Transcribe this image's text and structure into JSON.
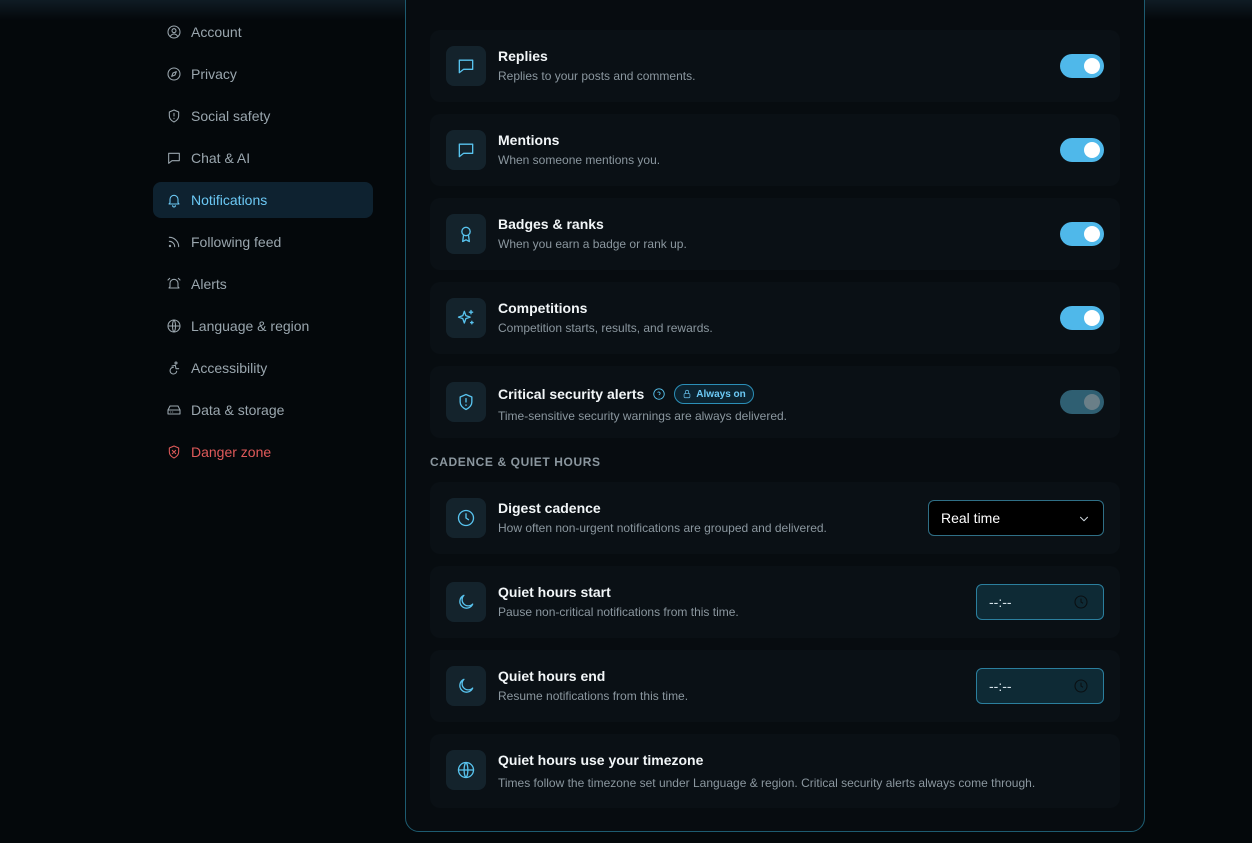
{
  "sidebar": {
    "items": [
      {
        "label": "Account",
        "icon": "user-circle-icon"
      },
      {
        "label": "Privacy",
        "icon": "compass-icon"
      },
      {
        "label": "Social safety",
        "icon": "shield-icon"
      },
      {
        "label": "Chat & AI",
        "icon": "message-icon"
      },
      {
        "label": "Notifications",
        "icon": "bell-icon",
        "active": true
      },
      {
        "label": "Following feed",
        "icon": "rss-icon"
      },
      {
        "label": "Alerts",
        "icon": "alarm-bell-icon"
      },
      {
        "label": "Language & region",
        "icon": "globe-icon"
      },
      {
        "label": "Accessibility",
        "icon": "accessibility-icon"
      },
      {
        "label": "Data & storage",
        "icon": "hard-drive-icon"
      },
      {
        "label": "Danger zone",
        "icon": "shield-x-icon",
        "danger": true
      }
    ]
  },
  "notifications": {
    "replies": {
      "title": "Replies",
      "desc": "Replies to your posts and comments.",
      "on": true
    },
    "mentions": {
      "title": "Mentions",
      "desc": "When someone mentions you.",
      "on": true
    },
    "badges": {
      "title": "Badges & ranks",
      "desc": "When you earn a badge or rank up.",
      "on": true
    },
    "competitions": {
      "title": "Competitions",
      "desc": "Competition starts, results, and rewards.",
      "on": true
    },
    "security": {
      "title": "Critical security alerts",
      "badge": "Always on",
      "desc": "Time-sensitive security warnings are always delivered.",
      "on": true,
      "disabled": true
    }
  },
  "cadence": {
    "section_label": "CADENCE & QUIET HOURS",
    "digest": {
      "title": "Digest cadence",
      "desc": "How often non-urgent notifications are grouped and delivered.",
      "value": "Real time"
    },
    "quiet_start": {
      "title": "Quiet hours start",
      "desc": "Pause non-critical notifications from this time.",
      "value": "--:--"
    },
    "quiet_end": {
      "title": "Quiet hours end",
      "desc": "Resume notifications from this time.",
      "value": "--:--"
    },
    "timezone": {
      "title": "Quiet hours use your timezone",
      "desc": "Times follow the timezone set under Language & region. Critical security alerts always come through."
    }
  },
  "colors": {
    "accent": "#4fb8ea",
    "danger": "#e05a5a",
    "panel_border": "#1d5b70"
  }
}
